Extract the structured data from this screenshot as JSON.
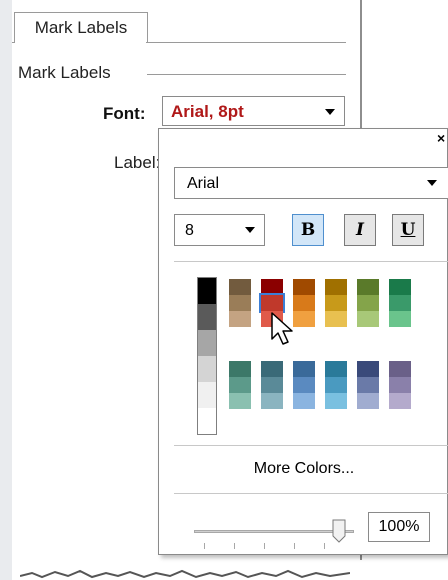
{
  "panel": {
    "tab_label": "Mark Labels",
    "group_label": "Mark Labels",
    "font_label": "Font:",
    "font_value": "Arial, 8pt",
    "label_label": "Label:"
  },
  "popup": {
    "close_glyph": "×",
    "font_family": "Arial",
    "font_size": "8",
    "bold_glyph": "B",
    "italic_glyph": "I",
    "underline_glyph": "U",
    "bold_active": true,
    "more_colors": "More Colors...",
    "opacity": "100%",
    "opacity_value": 1.0,
    "selected_color": "#c0392b"
  },
  "icons": [
    "close-icon",
    "chevron-down-icon",
    "cursor-arrow-icon"
  ],
  "palette": {
    "grays": [
      "#000000",
      "#5a5a5a",
      "#a6a6a6",
      "#d4d4d4",
      "#f0f0f0",
      "#ffffff"
    ],
    "top_columns": [
      [
        "#725b3e",
        "#9a7d58",
        "#c4a382"
      ],
      [
        "#8b0000",
        "#c0392b",
        "#e05a4a"
      ],
      [
        "#a04a00",
        "#d87a1a",
        "#f0a040"
      ],
      [
        "#a07000",
        "#c89a1a",
        "#e8c050"
      ],
      [
        "#5a7a2a",
        "#84a44a",
        "#a8c878"
      ],
      [
        "#1a7a4a",
        "#3a9a6a",
        "#6ac48c"
      ]
    ],
    "bottom_columns": [
      [
        "#3c7868",
        "#5c9a8a",
        "#8ac0b0"
      ],
      [
        "#3a6a78",
        "#5a8a98",
        "#8ab4c0"
      ],
      [
        "#3a6a9a",
        "#5a8ac0",
        "#8ab4e0"
      ],
      [
        "#2a7a9a",
        "#4a9ac0",
        "#7ac0e0"
      ],
      [
        "#3a4a7a",
        "#6a7aa8",
        "#a0acd0"
      ],
      [
        "#6a6088",
        "#8a80aa",
        "#b4aacc"
      ]
    ]
  }
}
